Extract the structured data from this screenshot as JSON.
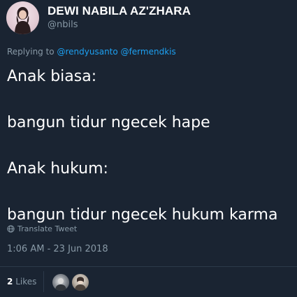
{
  "user": {
    "display_name": "DEWI NABILA AZ'ZHARA",
    "handle": "@nbils"
  },
  "reply": {
    "prefix": "Replying to",
    "mentions": [
      "@rendyusanto",
      "@fermendkis"
    ]
  },
  "tweet": {
    "lines": [
      "Anak biasa:",
      "",
      "bangun tidur ngecek hape",
      "",
      "Anak hukum:",
      "",
      "bangun tidur ngecek hukum karma"
    ]
  },
  "translate": {
    "label": "Translate Tweet",
    "icon": "globe-icon"
  },
  "timestamp": "1:06 AM - 23 Jun 2018",
  "likes": {
    "count": "2",
    "label": "Likes"
  },
  "colors": {
    "background": "#1a2432",
    "text": "#ffffff",
    "muted": "#8899a6",
    "link": "#1da1f2",
    "divider": "#2c3a4a"
  }
}
